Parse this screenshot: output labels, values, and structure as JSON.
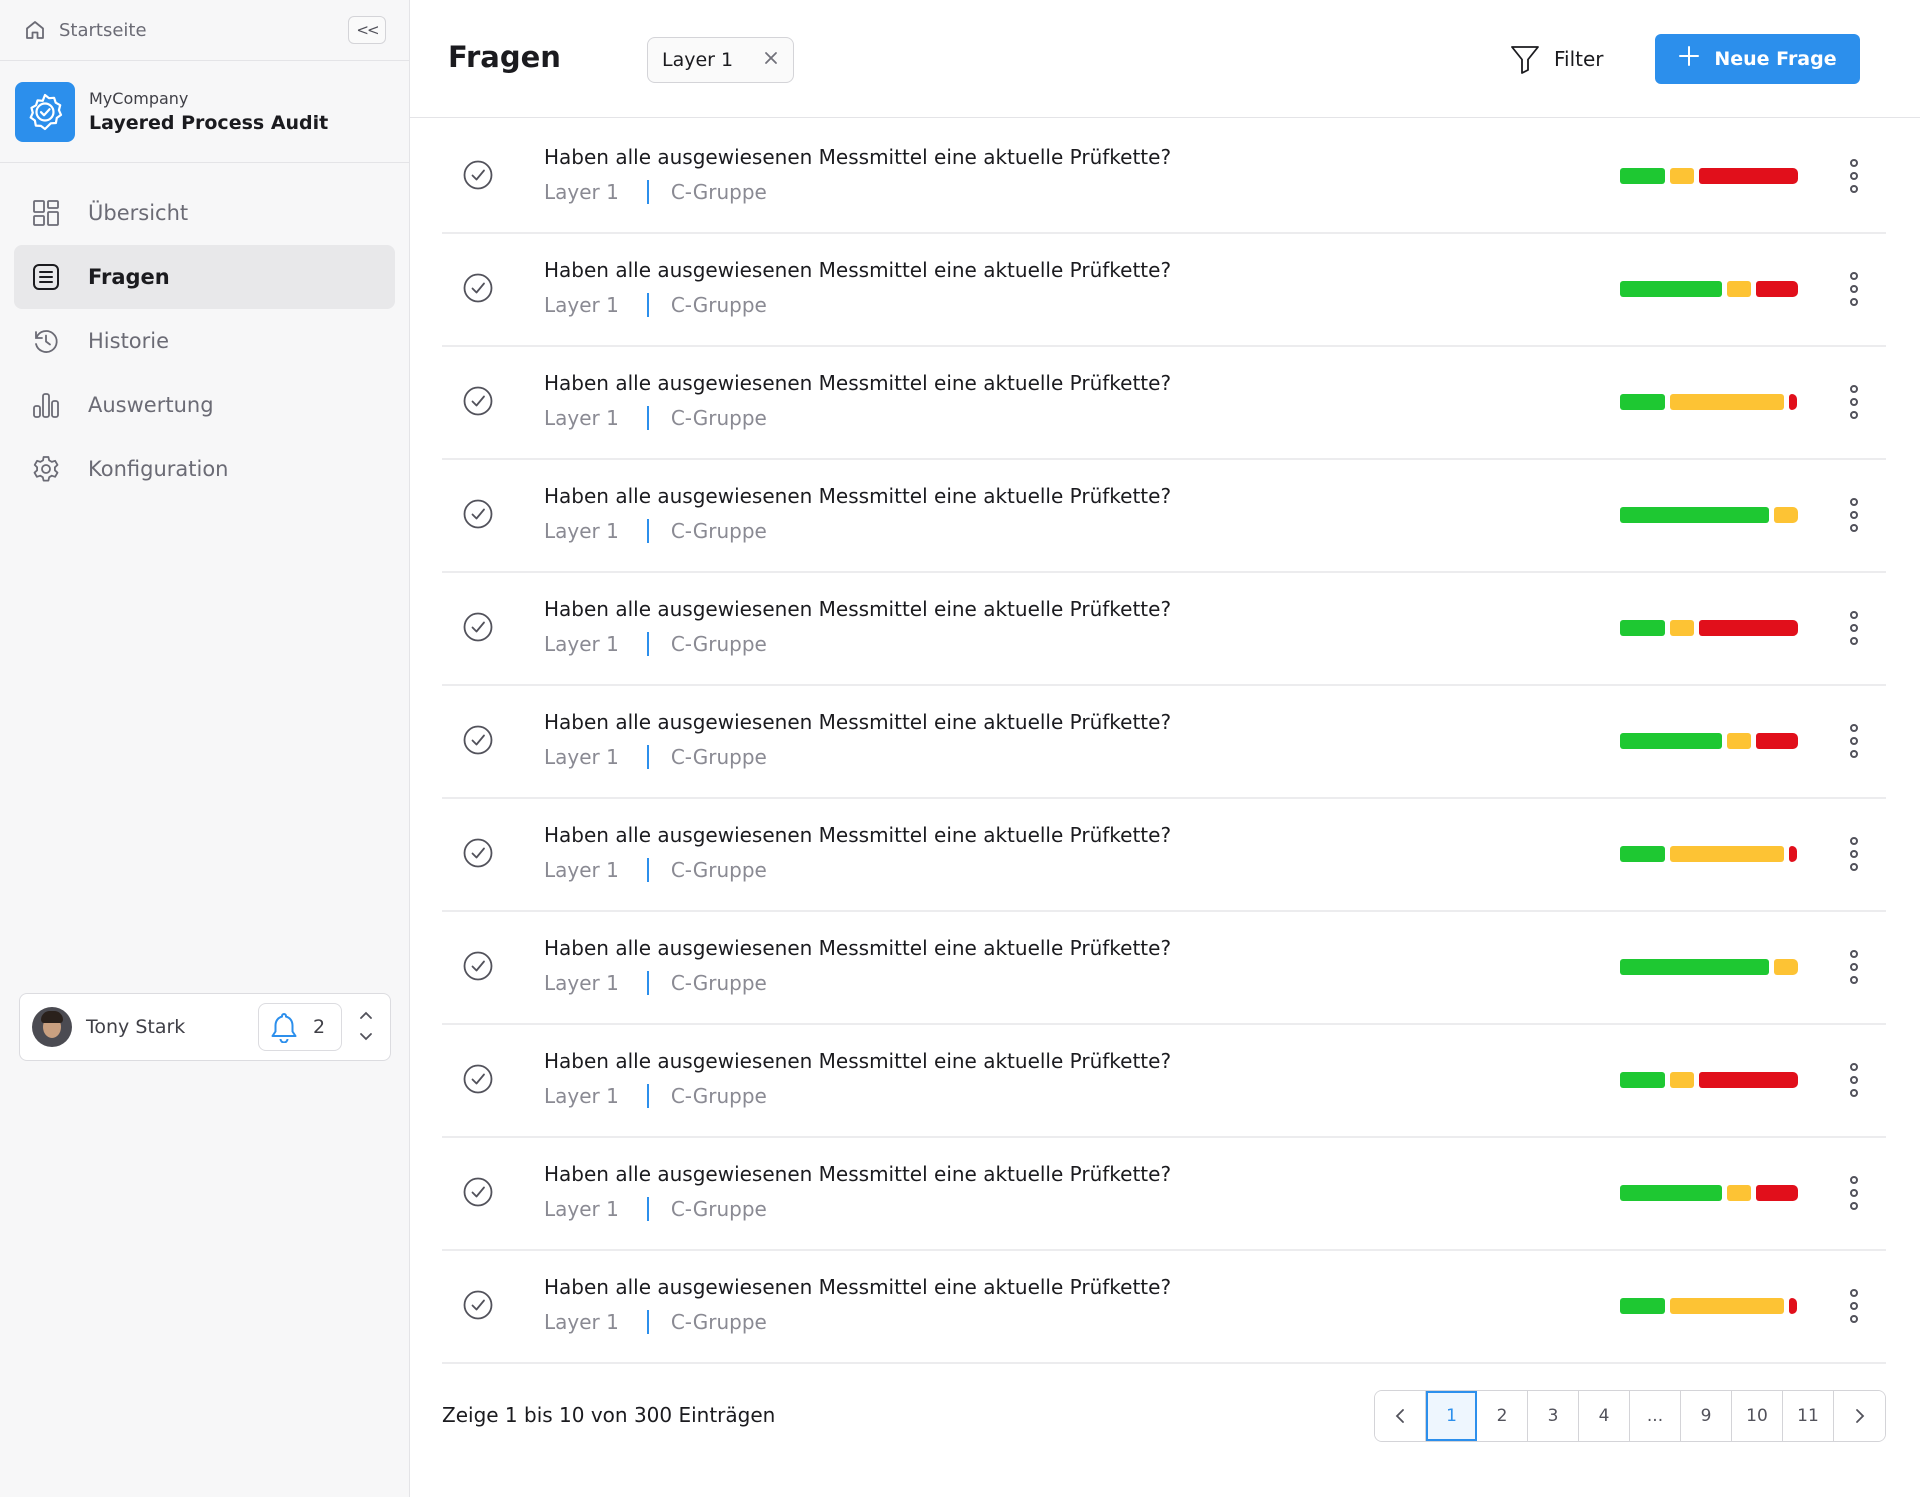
{
  "sidebar": {
    "home_label": "Startseite",
    "collapse_label": "<<",
    "brand": {
      "company": "MyCompany",
      "app": "Layered Process Audit"
    },
    "nav": [
      {
        "label": "Übersicht",
        "icon": "grid-icon",
        "active": false
      },
      {
        "label": "Fragen",
        "icon": "list-icon",
        "active": true
      },
      {
        "label": "Historie",
        "icon": "history-icon",
        "active": false
      },
      {
        "label": "Auswertung",
        "icon": "bar-chart-icon",
        "active": false
      },
      {
        "label": "Konfiguration",
        "icon": "gear-icon",
        "active": false
      }
    ],
    "user": {
      "name": "Tony Stark",
      "notification_count": "2"
    }
  },
  "header": {
    "title": "Fragen",
    "filter_chip": "Layer 1",
    "filter_label": "Filter",
    "new_button_label": "Neue Frage"
  },
  "colors": {
    "accent": "#2c8fec",
    "green": "#1ec832",
    "yellow": "#fdc334",
    "red": "#e10f1b"
  },
  "questions": [
    {
      "text": "Haben alle ausgewiesenen Messmittel eine aktuelle Prüfkette?",
      "layer": "Layer 1",
      "group": "C-Gruppe",
      "status": {
        "green": 0.27,
        "yellow": 0.14,
        "red": 0.59
      }
    },
    {
      "text": "Haben alle ausgewiesenen Messmittel eine aktuelle Prüfkette?",
      "layer": "Layer 1",
      "group": "C-Gruppe",
      "status": {
        "green": 0.61,
        "yellow": 0.14,
        "red": 0.25
      }
    },
    {
      "text": "Haben alle ausgewiesenen Messmittel eine aktuelle Prüfkette?",
      "layer": "Layer 1",
      "group": "C-Gruppe",
      "status": {
        "green": 0.27,
        "yellow": 0.68,
        "red": 0.05
      }
    },
    {
      "text": "Haben alle ausgewiesenen Messmittel eine aktuelle Prüfkette?",
      "layer": "Layer 1",
      "group": "C-Gruppe",
      "status": {
        "green": 0.86,
        "yellow": 0.14,
        "red": 0
      }
    },
    {
      "text": "Haben alle ausgewiesenen Messmittel eine aktuelle Prüfkette?",
      "layer": "Layer 1",
      "group": "C-Gruppe",
      "status": {
        "green": 0.27,
        "yellow": 0.14,
        "red": 0.59
      }
    },
    {
      "text": "Haben alle ausgewiesenen Messmittel eine aktuelle Prüfkette?",
      "layer": "Layer 1",
      "group": "C-Gruppe",
      "status": {
        "green": 0.61,
        "yellow": 0.14,
        "red": 0.25
      }
    },
    {
      "text": "Haben alle ausgewiesenen Messmittel eine aktuelle Prüfkette?",
      "layer": "Layer 1",
      "group": "C-Gruppe",
      "status": {
        "green": 0.27,
        "yellow": 0.68,
        "red": 0.05
      }
    },
    {
      "text": "Haben alle ausgewiesenen Messmittel eine aktuelle Prüfkette?",
      "layer": "Layer 1",
      "group": "C-Gruppe",
      "status": {
        "green": 0.86,
        "yellow": 0.14,
        "red": 0
      }
    },
    {
      "text": "Haben alle ausgewiesenen Messmittel eine aktuelle Prüfkette?",
      "layer": "Layer 1",
      "group": "C-Gruppe",
      "status": {
        "green": 0.27,
        "yellow": 0.14,
        "red": 0.59
      }
    },
    {
      "text": "Haben alle ausgewiesenen Messmittel eine aktuelle Prüfkette?",
      "layer": "Layer 1",
      "group": "C-Gruppe",
      "status": {
        "green": 0.61,
        "yellow": 0.14,
        "red": 0.25
      }
    },
    {
      "text": "Haben alle ausgewiesenen Messmittel eine aktuelle Prüfkette?",
      "layer": "Layer 1",
      "group": "C-Gruppe",
      "status": {
        "green": 0.27,
        "yellow": 0.68,
        "red": 0.05
      }
    }
  ],
  "footer": {
    "summary": "Zeige 1 bis 10 von 300 Einträgen",
    "pages": [
      "1",
      "2",
      "3",
      "4",
      "...",
      "9",
      "10",
      "11"
    ],
    "current_page": "1",
    "prev_label": "‹",
    "next_label": "›"
  }
}
